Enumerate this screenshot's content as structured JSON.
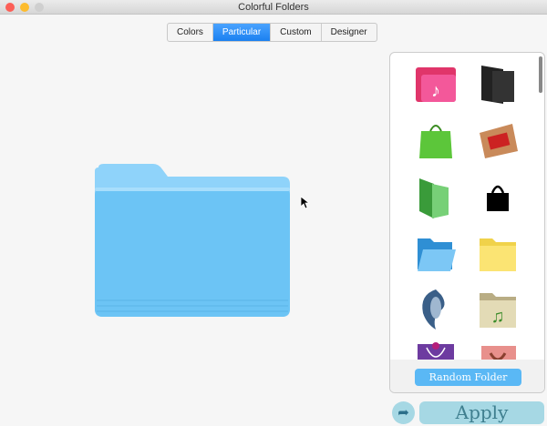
{
  "window": {
    "title": "Colorful Folders"
  },
  "tabs": [
    {
      "label": "Colors"
    },
    {
      "label": "Particular",
      "active": true
    },
    {
      "label": "Custom"
    },
    {
      "label": "Designer"
    }
  ],
  "preview": {
    "folder_color": "#6cc4f5"
  },
  "gallery": {
    "icons": [
      "music-folder-icon",
      "black-folder-icon",
      "green-bag-icon",
      "photo-folder-icon",
      "green-folder-icon",
      "black-bag-icon",
      "blue-open-folder-icon",
      "yellow-folder-icon",
      "dolphin-icon",
      "music-note-folder-icon",
      "purple-bag-icon",
      "pink-bag-icon"
    ],
    "random_button": "Random Folder"
  },
  "actions": {
    "apply": "Apply",
    "share_icon": "share-arrow-icon"
  }
}
